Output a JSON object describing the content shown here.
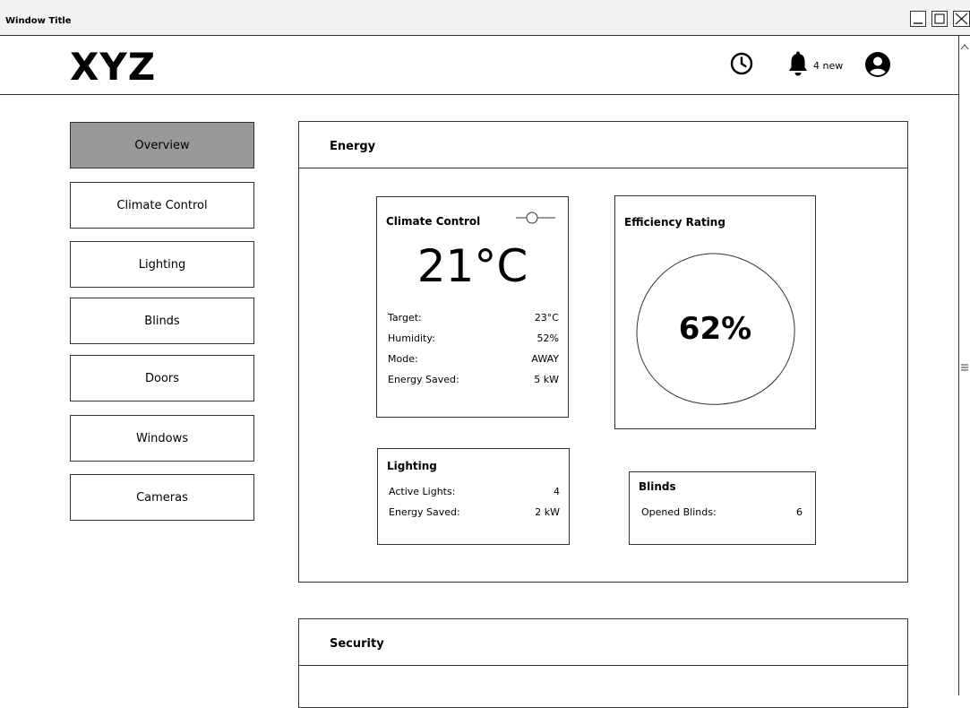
{
  "window": {
    "title": "Window Title"
  },
  "header": {
    "logo": "XYZ",
    "notifications_label": "4 new",
    "icons": [
      "clock-icon",
      "bell-icon",
      "user-account-icon"
    ]
  },
  "sidebar": {
    "items": [
      {
        "label": "Overview",
        "active": true
      },
      {
        "label": "Climate Control",
        "active": false
      },
      {
        "label": "Lighting",
        "active": false
      },
      {
        "label": "Blinds",
        "active": false
      },
      {
        "label": "Doors",
        "active": false
      },
      {
        "label": "Windows",
        "active": false
      },
      {
        "label": "Cameras",
        "active": false
      }
    ]
  },
  "energy": {
    "title": "Energy",
    "climate": {
      "title": "Climate Control",
      "temperature": "21°C",
      "rows": [
        {
          "label": "Target:",
          "value": "23°C"
        },
        {
          "label": "Humidity:",
          "value": "52%"
        },
        {
          "label": "Mode:",
          "value": "AWAY"
        },
        {
          "label": "Energy Saved:",
          "value": "5 kW"
        }
      ]
    },
    "efficiency": {
      "title": "Efficiency Rating",
      "value": "62%"
    },
    "lighting": {
      "title": "Lighting",
      "rows": [
        {
          "label": "Active Lights:",
          "value": "4"
        },
        {
          "label": "Energy Saved:",
          "value": "2 kW"
        }
      ]
    },
    "blinds": {
      "title": "Blinds",
      "rows": [
        {
          "label": "Opened Blinds:",
          "value": "6"
        }
      ]
    }
  },
  "security": {
    "title": "Security"
  },
  "colors": {
    "active_nav": "#999999",
    "border": "#333333",
    "background": "#ffffff"
  }
}
